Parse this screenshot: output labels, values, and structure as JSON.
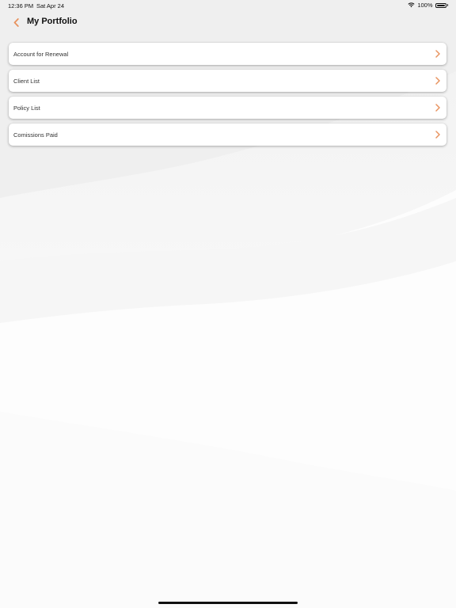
{
  "status_bar": {
    "time": "12:36 PM",
    "date": "Sat Apr 24",
    "battery": "100%",
    "wifi_icon": "wifi-icon",
    "battery_icon": "battery-icon"
  },
  "header": {
    "title": "My Portfolio",
    "back_icon": "chevron-left-icon"
  },
  "menu": {
    "items": [
      {
        "label": "Account for Renewal"
      },
      {
        "label": "Client List"
      },
      {
        "label": "Policy List"
      },
      {
        "label": "Comissions Paid"
      }
    ]
  },
  "colors": {
    "accent": "#e8935f",
    "background": "#f4f4f4",
    "card": "#ffffff",
    "text": "#111111"
  }
}
